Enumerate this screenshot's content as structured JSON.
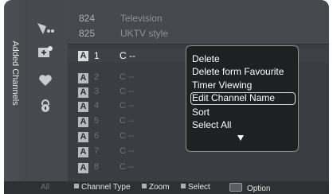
{
  "side_tab": {
    "label": "Added Channels"
  },
  "icons": [
    "antenna-icon",
    "add-channel-icon",
    "favourite-heart-icon",
    "lock-icon"
  ],
  "top_rows": [
    {
      "number": "824",
      "name": "Television"
    },
    {
      "number": "825",
      "name": "UKTV style"
    }
  ],
  "channels": [
    {
      "badge": "A",
      "number": "1",
      "name": "C --",
      "active": true
    },
    {
      "badge": "A",
      "number": "2",
      "name": "C --"
    },
    {
      "badge": "A",
      "number": "3",
      "name": "C --"
    },
    {
      "badge": "A",
      "number": "4",
      "name": "C --"
    },
    {
      "badge": "A",
      "number": "5",
      "name": "C --"
    },
    {
      "badge": "A",
      "number": "6",
      "name": "C --"
    },
    {
      "badge": "A",
      "number": "7",
      "name": "C --"
    },
    {
      "badge": "A",
      "number": "8",
      "name": "C --"
    }
  ],
  "menu": {
    "items": [
      "Delete",
      "Delete form Favourite",
      "Timer Viewing",
      "Edit Channel Name",
      "Sort",
      "Select All"
    ],
    "selected_index": 3
  },
  "bottom_bar": {
    "all_label": "All",
    "channel_type": "Channel Type",
    "zoom": "Zoom",
    "select": "Select",
    "option": "Option"
  }
}
